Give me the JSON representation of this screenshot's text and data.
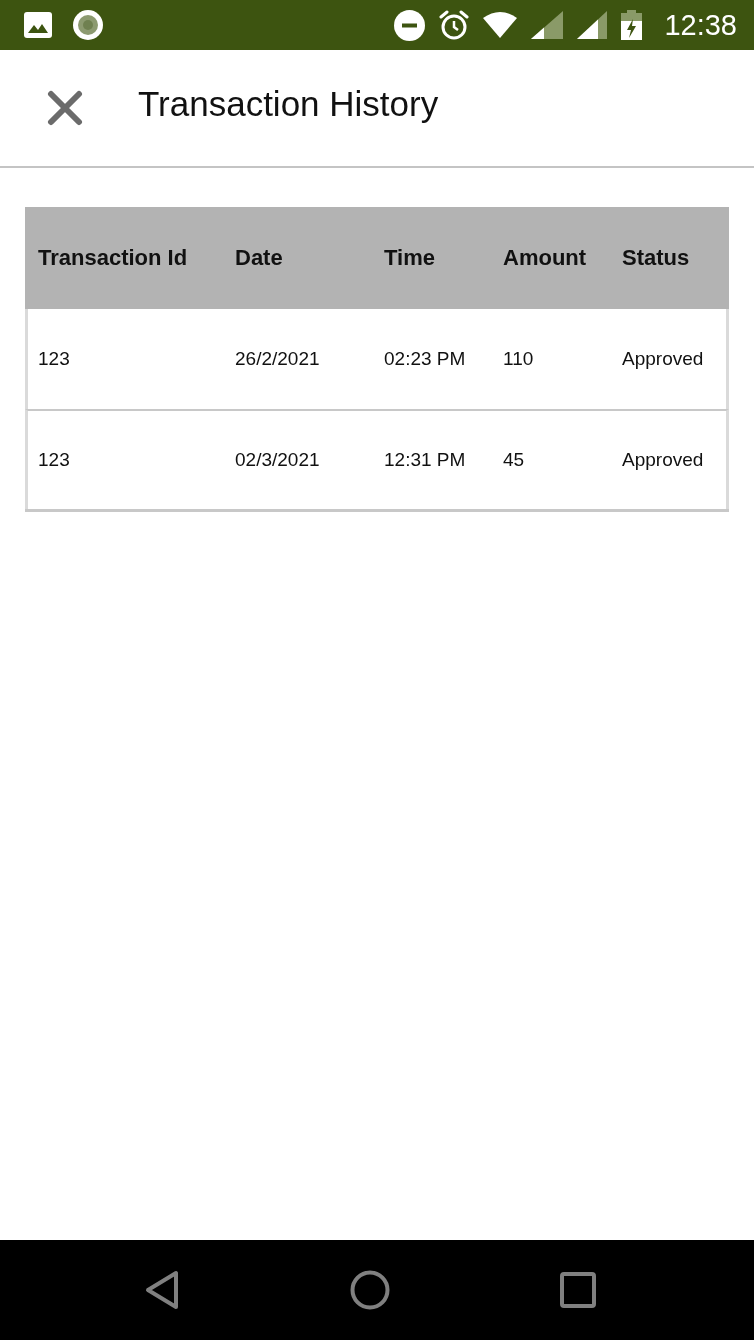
{
  "status_bar": {
    "time": "12:38"
  },
  "app_bar": {
    "title": "Transaction History"
  },
  "table": {
    "columns": [
      "Transaction Id",
      "Date",
      "Time",
      "Amount",
      "Status"
    ],
    "rows": [
      [
        "123",
        "26/2/2021",
        "02:23 PM",
        "110",
        "Approved"
      ],
      [
        "123",
        "02/3/2021",
        "12:31 PM",
        "45",
        "Approved"
      ]
    ]
  }
}
